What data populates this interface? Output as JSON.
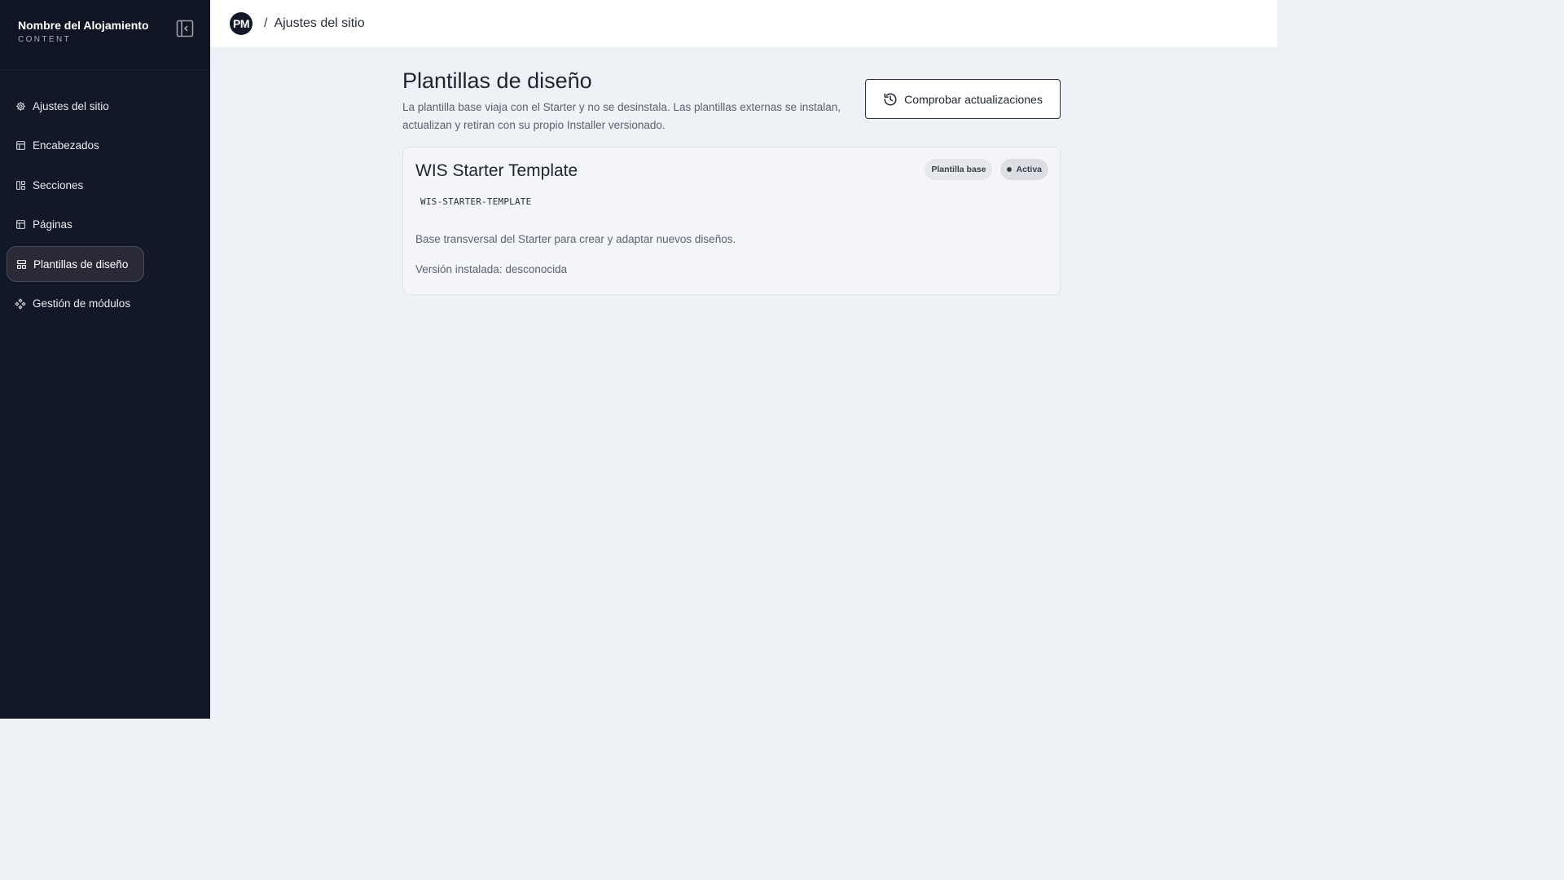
{
  "sidebar": {
    "title": "Nombre del Alojamiento",
    "subtitle": "CONTENT",
    "collapse_icon": "panel-collapse-icon",
    "items": [
      {
        "label": "Ajustes del sitio",
        "icon": "gear-icon",
        "active": false
      },
      {
        "label": "Encabezados",
        "icon": "layout-icon",
        "active": false
      },
      {
        "label": "Secciones",
        "icon": "sections-icon",
        "active": false
      },
      {
        "label": "Páginas",
        "icon": "layout-icon",
        "active": false
      },
      {
        "label": "Plantillas de diseño",
        "icon": "template-icon",
        "active": true
      },
      {
        "label": "Gestión de módulos",
        "icon": "modules-icon",
        "active": false
      }
    ]
  },
  "topbar": {
    "avatar": "PM",
    "separator": "/",
    "breadcrumb": "Ajustes del sitio"
  },
  "page": {
    "title": "Plantillas de diseño",
    "description": "La plantilla base viaja con el Starter y no se desinstala. Las plantillas externas se instalan, actualizan y retiran con su propio Installer versionado.",
    "check_button": "Comprobar actualizaciones",
    "check_icon": "history-icon"
  },
  "template_card": {
    "title": "WIS Starter Template",
    "badge_base": "Plantilla base",
    "badge_status": "Activa",
    "slug": "WIS-STARTER-TEMPLATE",
    "description": "Base transversal del Starter para crear y adaptar nuevos diseños.",
    "version": "Versión instalada: desconocida"
  },
  "colors": {
    "sidebar_bg": "#111827",
    "main_bg": "#eef1f5",
    "accent_dark": "#111827"
  }
}
